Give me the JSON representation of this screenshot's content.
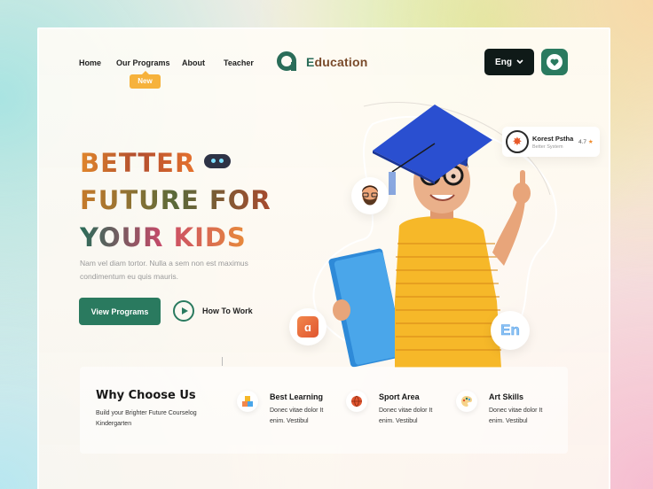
{
  "nav": {
    "links": [
      "Home",
      "Our Programs",
      "About",
      "Teacher"
    ],
    "new_badge": "New",
    "logo_text_first": "E",
    "logo_text_rest": "ducation",
    "lang_label": "Eng",
    "accent": "#2a7a5f"
  },
  "hero": {
    "line1": "BETTER",
    "line2": "FUTURE FOR",
    "line3": "YOUR KIDS",
    "description": "Nam vel diam tortor. Nulla a sem non est maximus condimentum eu quis mauris.",
    "primary_button": "View Programs",
    "secondary_button": "How To Work"
  },
  "floating_card": {
    "name": "Korest Pstha",
    "subtitle": "Better System",
    "rating": "4.7"
  },
  "bubbles": {
    "en_label": "En"
  },
  "why": {
    "title": "Why Choose Us",
    "description": "Build your Brighter Future Courselog Kindergarten",
    "features": [
      {
        "title": "Best Learning",
        "description": "Donec vitae dolor It enim. Vestibul",
        "icon": "blocks-icon"
      },
      {
        "title": "Sport Area",
        "description": "Donec vitae dolor It enim. Vestibul",
        "icon": "ball-icon"
      },
      {
        "title": "Art Skills",
        "description": "Donec vitae dolor It enim. Vestibul",
        "icon": "palette-icon"
      }
    ]
  }
}
